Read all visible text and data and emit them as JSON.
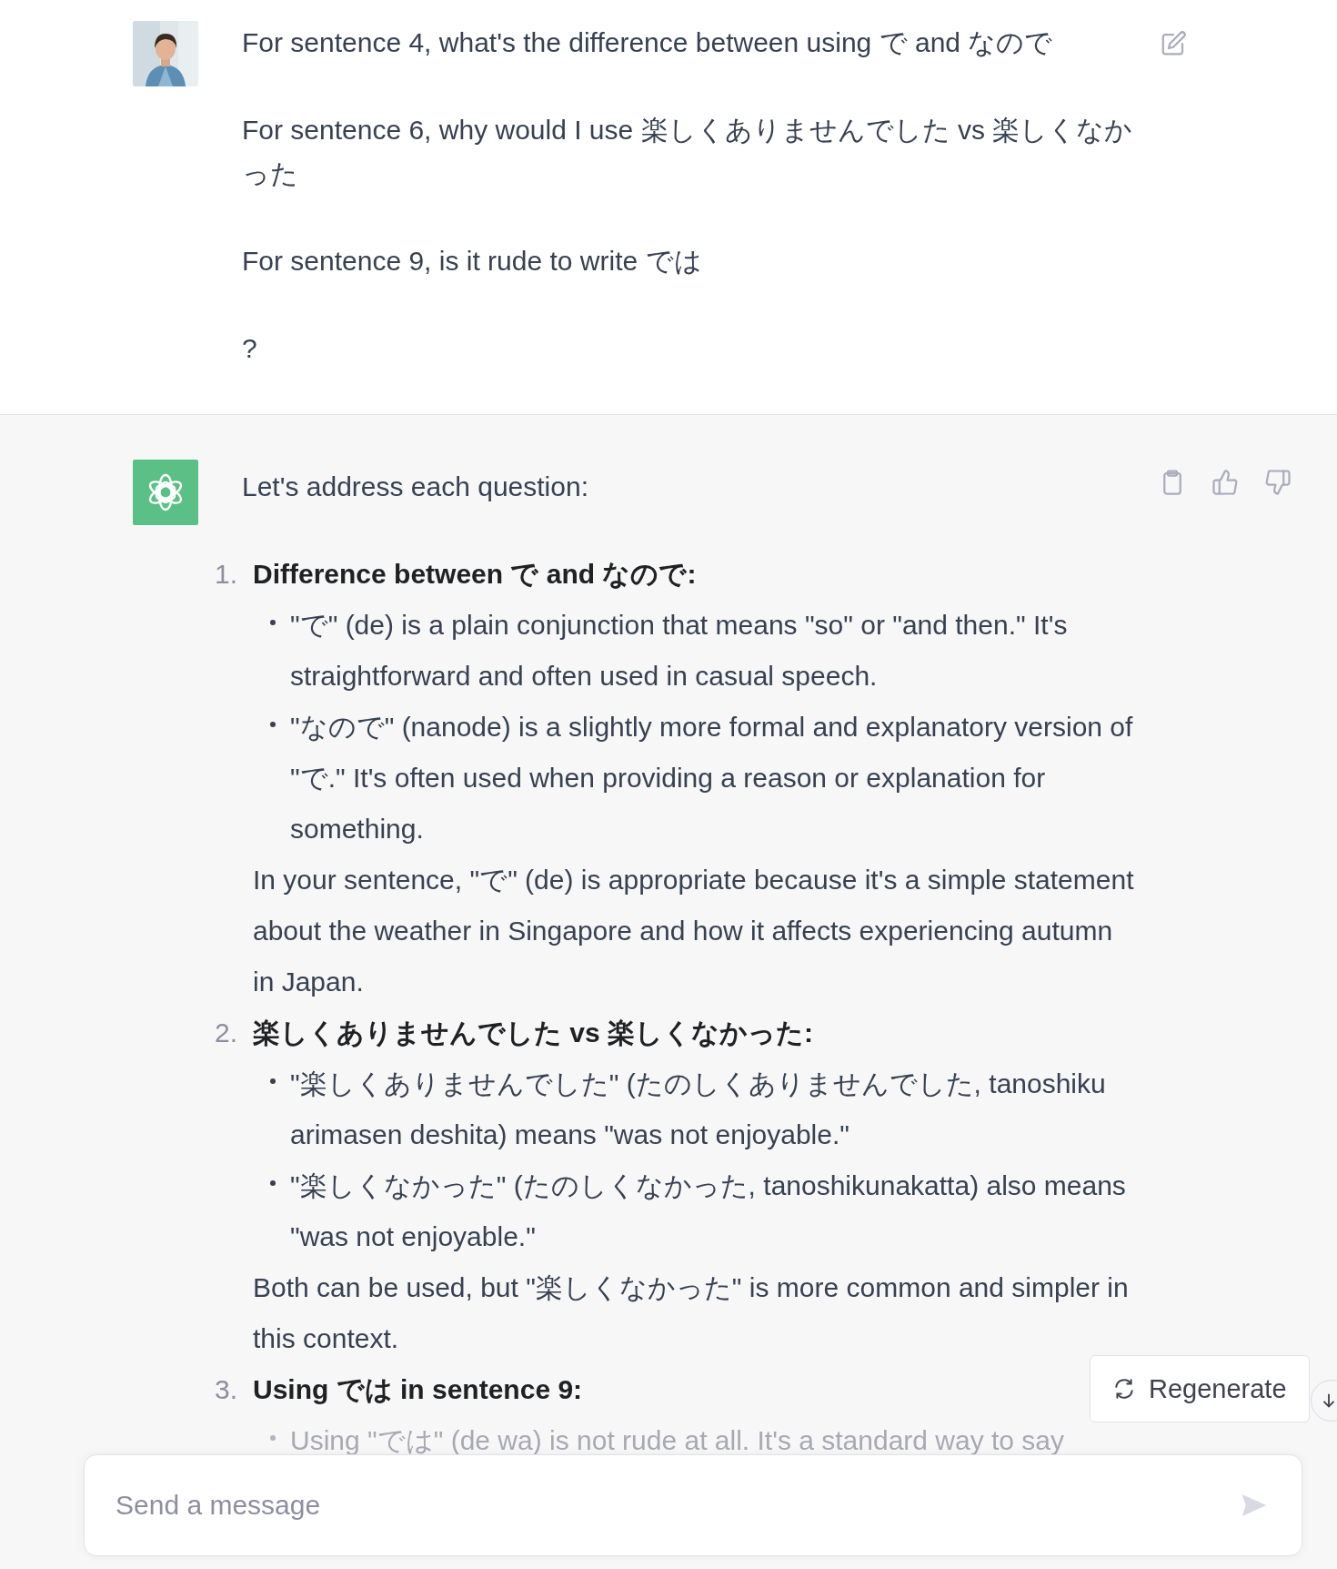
{
  "user_message": {
    "paragraphs": [
      "For sentence 4, what's the difference between using で and なので",
      "For sentence 6, why would I use 楽しくありませんでした vs 楽しくなかった",
      "For sentence 9, is it rude to write では",
      "?"
    ]
  },
  "assistant_message": {
    "intro": "Let's address each question:",
    "items": [
      {
        "number": "1.",
        "heading": "Difference between で and なので:",
        "bullets": [
          {
            "text": "\"で\" (de) is a plain conjunction that means \"so\" or \"and then.\" It's straightforward and often used in casual speech.",
            "faded": false
          },
          {
            "text": "\"なので\" (nanode) is a slightly more formal and explanatory version of \"で.\" It's often used when providing a reason or explanation for something.",
            "faded": false
          }
        ],
        "note": "In your sentence, \"で\" (de) is appropriate because it's a simple statement about the weather in Singapore and how it affects experiencing autumn in Japan."
      },
      {
        "number": "2.",
        "heading": "楽しくありませんでした vs 楽しくなかった:",
        "bullets": [
          {
            "text": "\"楽しくありませんでした\" (たのしくありませんでした, tanoshiku arimasen deshita) means \"was not enjoyable.\"",
            "faded": false
          },
          {
            "text": "\"楽しくなかった\" (たのしくなかった, tanoshikunakatta) also means \"was not enjoyable.\"",
            "faded": false
          }
        ],
        "note": "Both can be used, but \"楽しくなかった\" is more common and simpler in this context."
      },
      {
        "number": "3.",
        "heading": "Using では in sentence 9:",
        "bullets": [
          {
            "text": "Using \"では\" (de wa) is not rude at all. It's a standard way to say",
            "faded": true
          }
        ]
      }
    ]
  },
  "regenerate_button": {
    "label": "Regenerate"
  },
  "composer": {
    "placeholder": "Send a message"
  }
}
